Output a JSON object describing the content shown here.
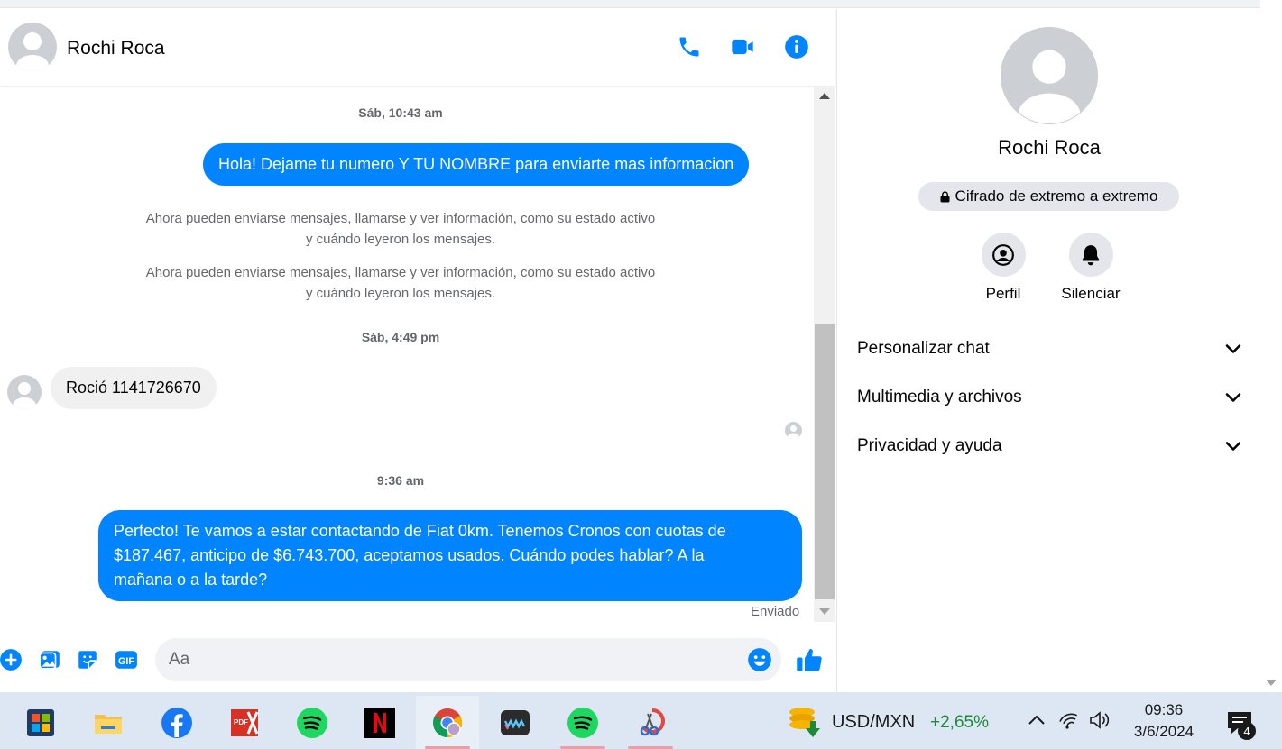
{
  "chat": {
    "contact_name": "Rochi Roca",
    "header_icons": [
      "phone-icon",
      "video-camera-icon",
      "info-icon"
    ]
  },
  "messages": {
    "ts1": "Sáb, 10:43 am",
    "msg1": "Hola! Dejame tu numero Y TU NOMBRE para enviarte mas informacion",
    "sys1_line1": "Ahora pueden enviarse mensajes, llamarse y ver información, como su estado activo",
    "sys1_line2": "y cuándo leyeron los mensajes.",
    "sys2_line1": "Ahora pueden enviarse mensajes, llamarse y ver información, como su estado activo",
    "sys2_line2": "y cuándo leyeron los mensajes.",
    "ts2": "Sáb, 4:49 pm",
    "msg2": "Roció 1141726670",
    "ts3": "9:36 am",
    "msg3_line1": "Perfecto! Te vamos a estar contactando de Fiat 0km. Tenemos Cronos con cuotas de",
    "msg3_line2": "$187.467, anticipo de $6.743.700, aceptamos usados. Cuándo podes hablar? A la",
    "msg3_line3": "mañana o a la tarde?",
    "status": "Enviado"
  },
  "composer": {
    "placeholder": "Aa",
    "icons": [
      "plus-icon",
      "image-icon",
      "sticker-icon",
      "gif-icon",
      "emoji-icon",
      "thumbs-up-icon"
    ]
  },
  "panel": {
    "name": "Rochi Roca",
    "encryption": "Cifrado de extremo a extremo",
    "actions": {
      "profile": "Perfil",
      "mute": "Silenciar"
    },
    "sections": [
      "Personalizar chat",
      "Multimedia y archivos",
      "Privacidad y ayuda"
    ]
  },
  "taskbar": {
    "apps": [
      "start",
      "file-explorer",
      "facebook",
      "pdf-editor",
      "spotify",
      "netflix",
      "chrome",
      "wuwu",
      "spotify",
      "snipping-tool"
    ],
    "ticker": "USD/MXN",
    "change": "+2,65%",
    "time": "09:36",
    "date": "3/6/2024",
    "notifications": "4"
  },
  "colors": {
    "accent": "#0084ff",
    "bubble_in": "#f0f0f0",
    "ticker_up": "#1d8a3a"
  }
}
